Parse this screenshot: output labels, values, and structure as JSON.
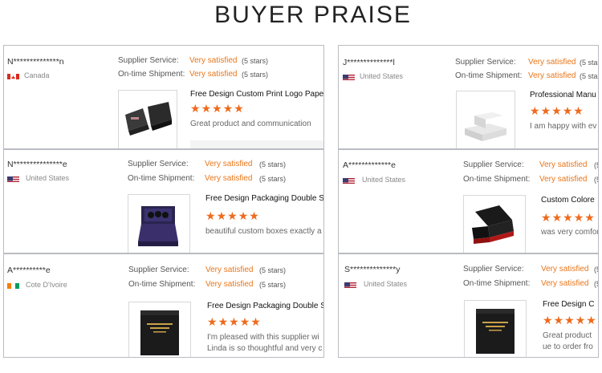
{
  "page": {
    "title": "BUYER PRAISE"
  },
  "labels": {
    "supplier": "Supplier Service:",
    "shipment": "On-time Shipment:",
    "satisfied": "Very satisfied",
    "stars_note": "(5 stars)"
  },
  "rating_stars": 5,
  "colors": {
    "accent": "#e8761b",
    "star": "#ee6a1d",
    "border": "#b9bcc2"
  },
  "reviews": [
    {
      "name": "N**************n",
      "country": "Canada",
      "flag": "canada-flag",
      "product": "Free Design Custom Print Logo Paper S",
      "comment": [
        "Great product and communication"
      ]
    },
    {
      "name": "N***************e",
      "country": "United States",
      "flag": "us-flag",
      "product": "Free Design Packaging Double S",
      "comment": [
        "beautiful custom boxes exactly a"
      ]
    },
    {
      "name": "A**********e",
      "country": "Cote D'Ivoire",
      "flag": "cote-divoire-flag",
      "product": "Free Design Packaging Double S",
      "comment": [
        "I'm pleased with this supplier wi",
        "Linda is so thoughtful and very c"
      ]
    },
    {
      "name": "J**************l",
      "country": "United States",
      "flag": "us-flag",
      "product": "Professional Manu",
      "comment": [
        "I am happy with ev"
      ]
    },
    {
      "name": "A*************e",
      "country": "United States",
      "flag": "us-flag",
      "product": "Custom Colore",
      "comment": [
        "was very comfor"
      ]
    },
    {
      "name": "S**************y",
      "country": "United States",
      "flag": "us-flag",
      "product": "Free Design C",
      "comment": [
        "Great product",
        "ue to order fro"
      ]
    }
  ]
}
